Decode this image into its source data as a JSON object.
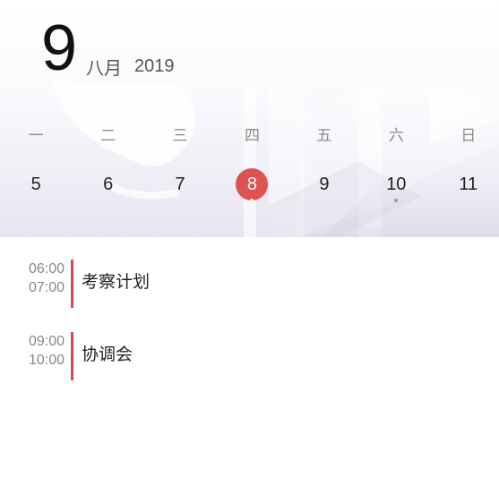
{
  "header": {
    "day": "9",
    "month": "八月",
    "year": "2019"
  },
  "week": {
    "weekdays": [
      "一",
      "二",
      "三",
      "四",
      "五",
      "六",
      "日"
    ],
    "days": [
      "5",
      "6",
      "7",
      "8",
      "9",
      "10",
      "11"
    ],
    "selected_day": "8",
    "days_with_events": [
      "8",
      "10"
    ]
  },
  "events": [
    {
      "start": "06:00",
      "end": "07:00",
      "title": "考察计划"
    },
    {
      "start": "09:00",
      "end": "10:00",
      "title": "协调会"
    }
  ],
  "colors": {
    "accent": "#e05252",
    "event_bar": "#d84a4a",
    "event_dot": "#9a9a9a"
  }
}
